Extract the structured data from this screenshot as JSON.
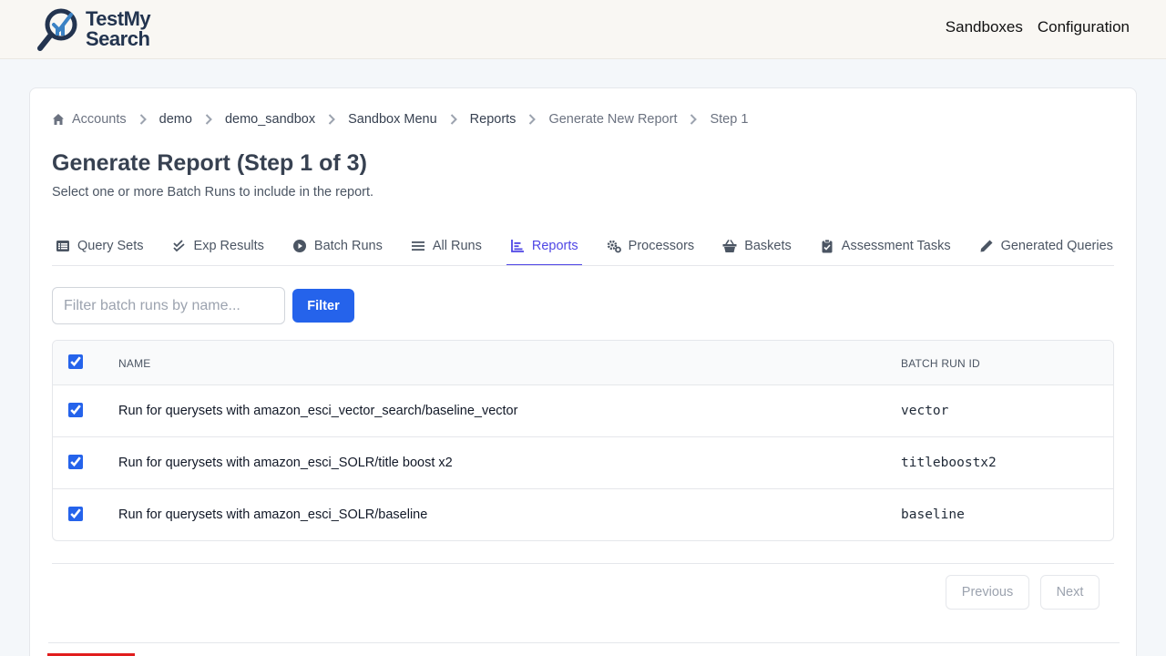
{
  "app": {
    "logo_text_line1": "TestMy",
    "logo_text_line2": "Search",
    "nav": [
      "Sandboxes",
      "Configuration"
    ]
  },
  "breadcrumb": [
    {
      "label": "Accounts",
      "style": "home"
    },
    {
      "label": "demo",
      "style": "dark"
    },
    {
      "label": "demo_sandbox",
      "style": "dark"
    },
    {
      "label": "Sandbox Menu",
      "style": "dark"
    },
    {
      "label": "Reports",
      "style": "dark"
    },
    {
      "label": "Generate New Report",
      "style": "muted"
    },
    {
      "label": "Step 1",
      "style": "muted"
    }
  ],
  "page": {
    "title": "Generate Report (Step 1 of 3)",
    "subtitle": "Select one or more Batch Runs to include in the report."
  },
  "tabs": [
    {
      "label": "Query Sets",
      "icon": "list-icon",
      "active": false
    },
    {
      "label": "Exp Results",
      "icon": "double-check-icon",
      "active": false
    },
    {
      "label": "Batch Runs",
      "icon": "play-circle-icon",
      "active": false
    },
    {
      "label": "All Runs",
      "icon": "menu-lines-icon",
      "active": false
    },
    {
      "label": "Reports",
      "icon": "bar-chart-icon",
      "active": true
    },
    {
      "label": "Processors",
      "icon": "gears-icon",
      "active": false
    },
    {
      "label": "Baskets",
      "icon": "basket-icon",
      "active": false
    },
    {
      "label": "Assessment Tasks",
      "icon": "clipboard-check-icon",
      "active": false
    },
    {
      "label": "Generated Queries",
      "icon": "pencil-icon",
      "active": false
    }
  ],
  "filter": {
    "placeholder": "Filter batch runs by name...",
    "value": "",
    "button_label": "Filter"
  },
  "table": {
    "columns": [
      "NAME",
      "BATCH RUN ID"
    ],
    "select_all_checked": true,
    "rows": [
      {
        "name": "Run for querysets with amazon_esci_vector_search/baseline_vector",
        "id": "vector",
        "checked": true
      },
      {
        "name": "Run for querysets with amazon_esci_SOLR/title boost x2",
        "id": "titleboostx2",
        "checked": true
      },
      {
        "name": "Run for querysets with amazon_esci_SOLR/baseline",
        "id": "baseline",
        "checked": true
      }
    ]
  },
  "pager": {
    "previous_label": "Previous",
    "next_label": "Next"
  },
  "colors": {
    "accent": "#4f46e5",
    "primary_button": "#2563eb",
    "brand": "#23344f"
  }
}
